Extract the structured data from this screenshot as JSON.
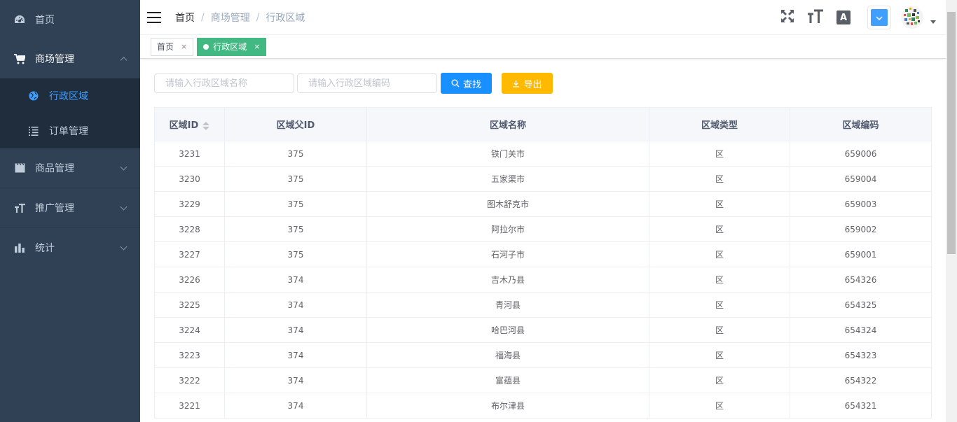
{
  "sidebar": {
    "items": [
      {
        "label": "首页",
        "icon": "dashboard-icon"
      },
      {
        "label": "商场管理",
        "icon": "cart-icon",
        "expanded": true,
        "children": [
          {
            "label": "行政区域",
            "icon": "globe-icon",
            "active": true
          },
          {
            "label": "订单管理",
            "icon": "list-icon"
          }
        ]
      },
      {
        "label": "商品管理",
        "icon": "clapperboard-icon"
      },
      {
        "label": "推广管理",
        "icon": "text-size-icon"
      },
      {
        "label": "统计",
        "icon": "bar-chart-icon"
      }
    ],
    "colors": {
      "bg": "#304156",
      "active": "#409eff",
      "text": "#bfcbd9"
    }
  },
  "navbar": {
    "breadcrumb": [
      "首页",
      "商场管理",
      "行政区域"
    ],
    "size_glyph": "тT",
    "lang_glyph": "A"
  },
  "tags": [
    {
      "label": "首页",
      "active": false
    },
    {
      "label": "行政区域",
      "active": true
    }
  ],
  "filter": {
    "name_placeholder": "请输入行政区域名称",
    "code_placeholder": "请输入行政区域编码",
    "search_label": "查找",
    "export_label": "导出"
  },
  "table": {
    "headers": [
      "区域ID",
      "区域父ID",
      "区域名称",
      "区域类型",
      "区域编码"
    ],
    "rows": [
      [
        "3231",
        "375",
        "铁门关市",
        "区",
        "659006"
      ],
      [
        "3230",
        "375",
        "五家渠市",
        "区",
        "659004"
      ],
      [
        "3229",
        "375",
        "图木舒克市",
        "区",
        "659003"
      ],
      [
        "3228",
        "375",
        "阿拉尔市",
        "区",
        "659002"
      ],
      [
        "3227",
        "375",
        "石河子市",
        "区",
        "659001"
      ],
      [
        "3226",
        "374",
        "吉木乃县",
        "区",
        "654326"
      ],
      [
        "3225",
        "374",
        "青河县",
        "区",
        "654325"
      ],
      [
        "3224",
        "374",
        "哈巴河县",
        "区",
        "654324"
      ],
      [
        "3223",
        "374",
        "福海县",
        "区",
        "654323"
      ],
      [
        "3222",
        "374",
        "富蕴县",
        "区",
        "654322"
      ],
      [
        "3221",
        "374",
        "布尔津县",
        "区",
        "654321"
      ]
    ]
  },
  "colors": {
    "primary": "#1890ff",
    "warning": "#ffba00",
    "tag_active": "#42b983"
  }
}
